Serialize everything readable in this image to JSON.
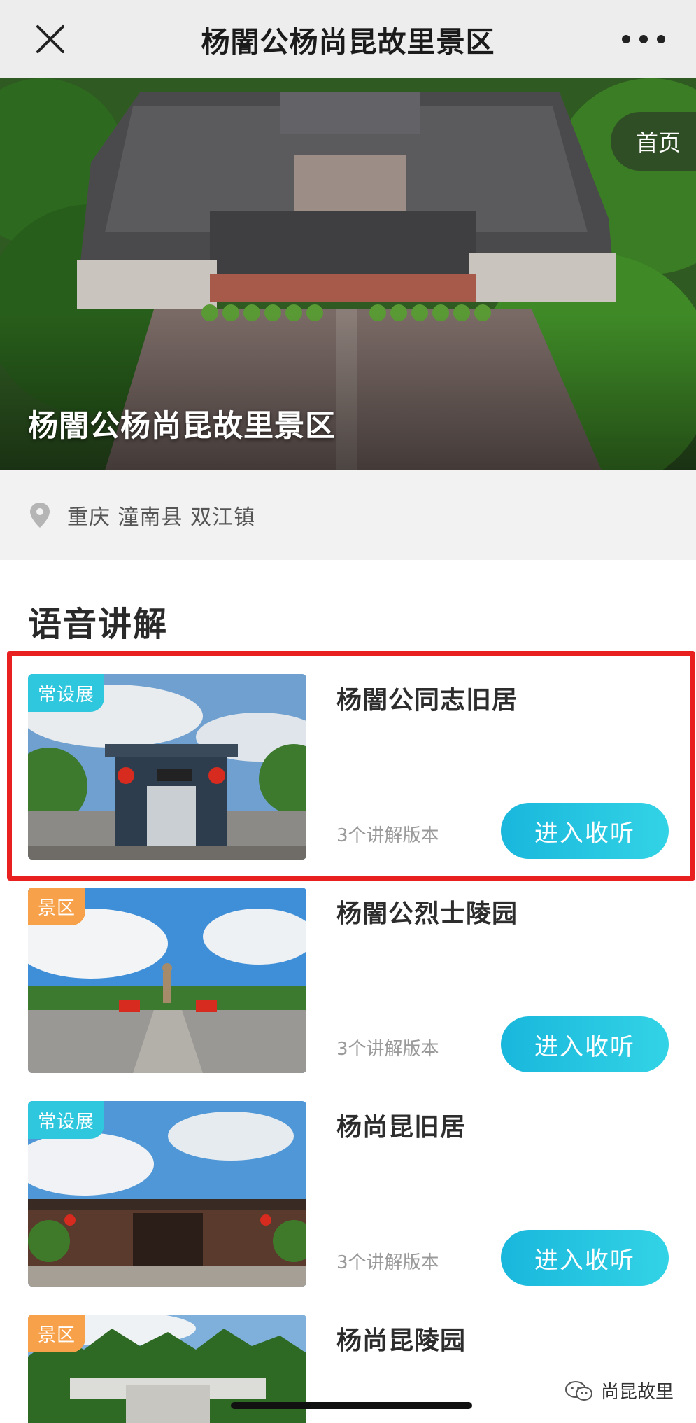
{
  "nav": {
    "title": "杨闇公杨尚昆故里景区",
    "close_icon": "close-icon",
    "more_icon": "more-icon"
  },
  "hero": {
    "home_label": "首页",
    "title": "杨闇公杨尚昆故里景区"
  },
  "location": {
    "icon": "location-pin-icon",
    "text": "重庆 潼南县 双江镇"
  },
  "section": {
    "title": "语音讲解"
  },
  "cards": [
    {
      "badge": "常设展",
      "badge_color": "#2ec7dd",
      "title": "杨闇公同志旧居",
      "versions": "3个讲解版本",
      "button": "进入收听"
    },
    {
      "badge": "景区",
      "badge_color": "#f7a14a",
      "title": "杨闇公烈士陵园",
      "versions": "3个讲解版本",
      "button": "进入收听"
    },
    {
      "badge": "常设展",
      "badge_color": "#2ec7dd",
      "title": "杨尚昆旧居",
      "versions": "3个讲解版本",
      "button": "进入收听"
    },
    {
      "badge": "景区",
      "badge_color": "#f7a14a",
      "title": "杨尚昆陵园"
    }
  ],
  "watermark": {
    "icon": "wechat-icon",
    "text": "尚昆故里"
  },
  "colors": {
    "accent": "#19b7dc",
    "highlight_border": "#e8201f"
  }
}
